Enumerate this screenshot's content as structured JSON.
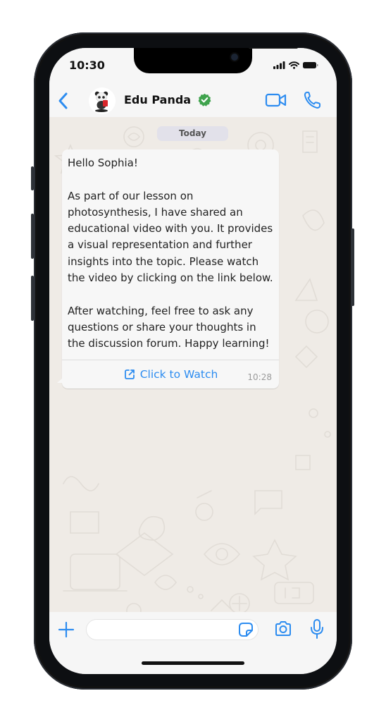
{
  "status_bar": {
    "time": "10:30"
  },
  "header": {
    "contact_name": "Edu Panda",
    "verified": true,
    "icons": {
      "back": "chevron-left-icon",
      "video": "video-camera-icon",
      "call": "phone-icon",
      "verified": "verified-badge-icon"
    }
  },
  "chat": {
    "date_label": "Today",
    "messages": [
      {
        "text": "Hello Sophia!\n\nAs part of our lesson on photosynthesis, I have shared an educational video with you. It provides a visual representation and further insights into the topic. Please watch the video by clicking on the link below.\n\nAfter watching, feel free to ask any questions or share your thoughts in the discussion forum. Happy learning!",
        "time": "10:28",
        "button_label": "Click to Watch",
        "button_icon": "external-link-icon"
      }
    ]
  },
  "composer": {
    "input_value": "",
    "input_placeholder": "",
    "icons": {
      "plus": "plus-icon",
      "sticker": "sticker-icon",
      "camera": "camera-icon",
      "mic": "microphone-icon"
    }
  },
  "colors": {
    "accent": "#2c8cf0",
    "verified": "#3fa34d",
    "chat_background": "#efebe6",
    "bubble": "#f7f7f7",
    "bars": "#f6f6f6"
  }
}
